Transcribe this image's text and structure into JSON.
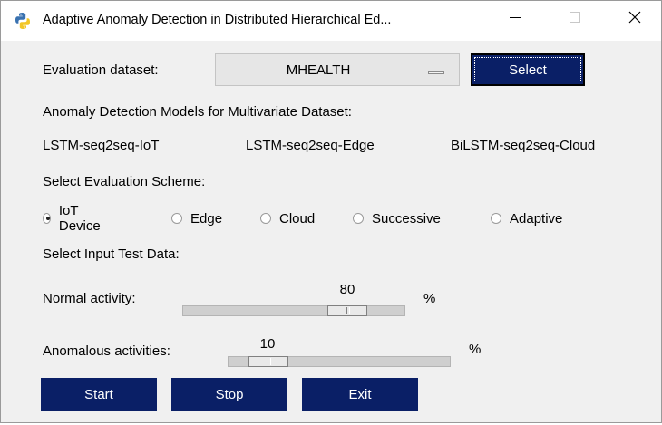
{
  "window": {
    "title": "Adaptive Anomaly Detection in Distributed Hierarchical Ed...",
    "icon": "python-icon",
    "controls": [
      "minimize-icon",
      "maximize-icon",
      "close-icon"
    ]
  },
  "dataset": {
    "label": "Evaluation dataset:",
    "selected": "MHEALTH",
    "button": "Select"
  },
  "models": {
    "heading": "Anomaly Detection Models for Multivariate Dataset:",
    "items": [
      "LSTM-seq2seq-IoT",
      "LSTM-seq2seq-Edge",
      "BiLSTM-seq2seq-Cloud"
    ]
  },
  "scheme": {
    "heading": "Select Evaluation Scheme:",
    "options": [
      "IoT Device",
      "Edge",
      "Cloud",
      "Successive",
      "Adaptive"
    ],
    "selected": "IoT Device"
  },
  "input": {
    "heading": "Select Input Test Data:",
    "normal": {
      "label": "Normal activity:",
      "value": "80",
      "unit": "%"
    },
    "anomalous": {
      "label": "Anomalous activities:",
      "value": "10",
      "unit": "%"
    }
  },
  "actions": {
    "start": "Start",
    "stop": "Stop",
    "exit": "Exit"
  },
  "colors": {
    "button_bg": "#0a1f66",
    "window_bg": "#f0f0f0"
  }
}
